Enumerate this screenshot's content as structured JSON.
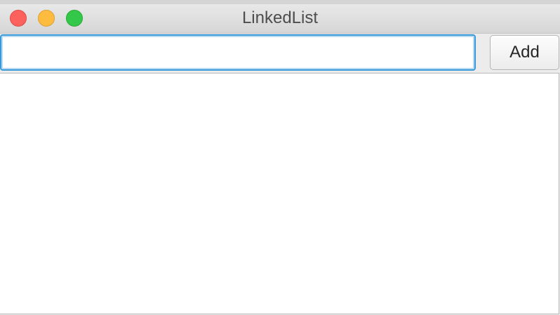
{
  "window": {
    "title": "LinkedList"
  },
  "toolbar": {
    "input_value": "",
    "add_label": "Add"
  },
  "list": {
    "items": []
  }
}
